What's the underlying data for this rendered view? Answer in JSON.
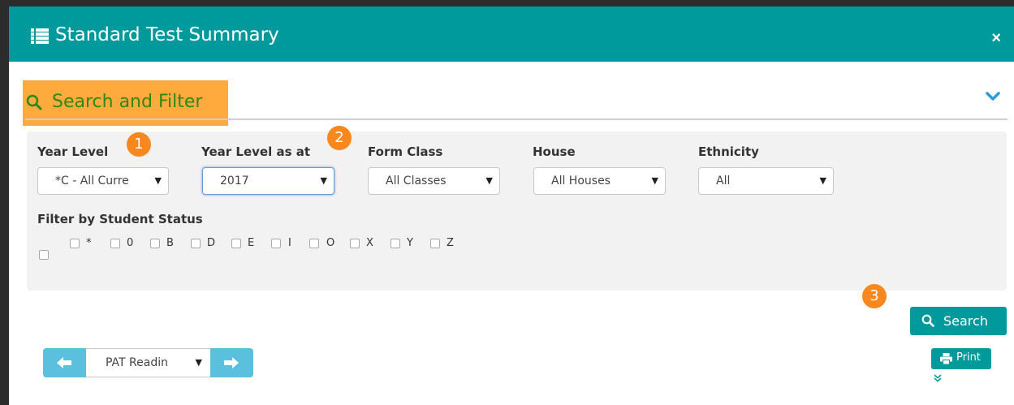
{
  "header": {
    "title": "Standard Test Summary",
    "close_label": "×"
  },
  "search_filter": {
    "title": "Search and Filter"
  },
  "filters": {
    "year_level": {
      "label": "Year Level",
      "value": "*C - All Curre"
    },
    "year_level_as_at": {
      "label": "Year Level as at",
      "value": "2017"
    },
    "form_class": {
      "label": "Form Class",
      "value": "All Classes"
    },
    "house": {
      "label": "House",
      "value": "All Houses"
    },
    "ethnicity": {
      "label": "Ethnicity",
      "value": "All"
    },
    "student_status": {
      "label": "Filter by Student Status",
      "options": [
        "*",
        "0",
        "B",
        "D",
        "E",
        "I",
        "O",
        "X",
        "Y",
        "Z"
      ]
    }
  },
  "badges": [
    "1",
    "2",
    "3"
  ],
  "actions": {
    "search_label": "Search",
    "print_label": "Print"
  },
  "nav": {
    "test_value": "PAT Readin"
  },
  "colors": {
    "header": "#00999c",
    "highlight": "#ffaa3c",
    "badge": "#f7881f",
    "nav": "#5bc0de",
    "accent_text": "#2a8a1a"
  }
}
